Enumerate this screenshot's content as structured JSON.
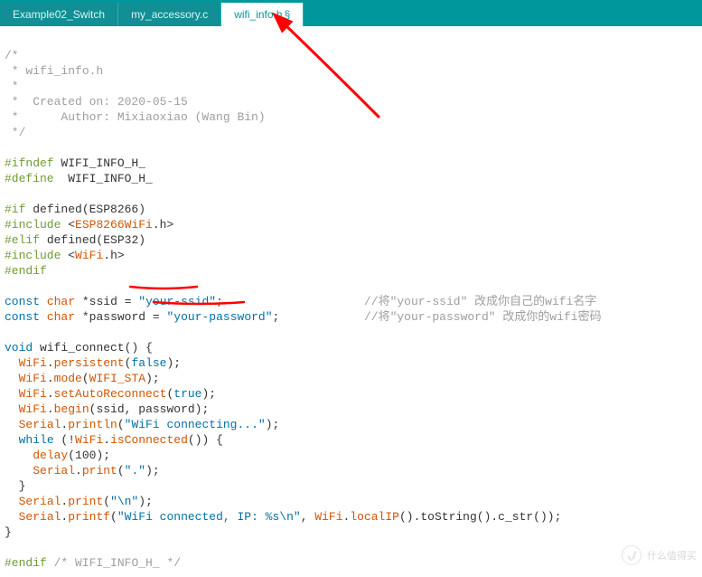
{
  "tabs": [
    {
      "label": "Example02_Switch",
      "active": false,
      "modified": false
    },
    {
      "label": "my_accessory.c",
      "active": false,
      "modified": false
    },
    {
      "label": "wifi_info.h",
      "active": true,
      "modified": true,
      "mod_mark": "§"
    }
  ],
  "code": {
    "c1": "/*",
    "c2": " * wifi_info.h",
    "c3": " *",
    "c4": " *  Created on: 2020-05-15",
    "c5": " *      Author: Mixiaoxiao (Wang Bin)",
    "c6": " */",
    "ifndef": "#ifndef",
    "ifndef_v": "WIFI_INFO_H_",
    "define": "#define",
    "define_v": "WIFI_INFO_H_",
    "if": "#if",
    "defined1": "defined(ESP8266)",
    "include": "#include",
    "lt": "<",
    "gt": ">",
    "lib8266": "ESP8266WiFi",
    "doth": ".h",
    "elif": "#elif",
    "defined2": "defined(ESP32)",
    "libwifi": "WiFi",
    "endif": "#endif",
    "const": "const",
    "char": "char",
    "star": "*",
    "ssid_name": "ssid",
    "eq": " = ",
    "ssid_val": "\"your-ssid\"",
    "semi": ";",
    "ssid_cmt": "//将\"your-ssid\" 改成你自己的wifi名字",
    "pwd_name": "password",
    "pwd_val": "\"your-password\"",
    "pwd_cmt": "//将\"your-password\" 改成你的wifi密码",
    "void": "void",
    "fn": "wifi_connect",
    "paren": "()",
    "brace_o": " {",
    "WiFi": "WiFi",
    "dot": ".",
    "persistent": "persistent",
    "false": "false",
    "mode": "mode",
    "WIFI_STA": "WIFI_STA",
    "setAutoReconnect": "setAutoReconnect",
    "true": "true",
    "begin": "begin",
    "begin_args": "(ssid, password)",
    "Serial": "Serial",
    "println": "println",
    "connecting": "\"WiFi connecting...\"",
    "while": "while",
    "bang": "!",
    "isConnected": "isConnected",
    "empty_call": "()",
    "delay": "delay",
    "d100": "100",
    "print": "print",
    "dotstr": "\".\"",
    "brace_c": "}",
    "nl": "\"\\n\"",
    "printf": "printf",
    "connected": "\"WiFi connected, IP: %s\\n\"",
    "localIP": "localIP",
    "chain": ".toString().c_str())",
    "end_c": "/* WIFI_INFO_H_ */"
  },
  "watermark": "什么值得买"
}
